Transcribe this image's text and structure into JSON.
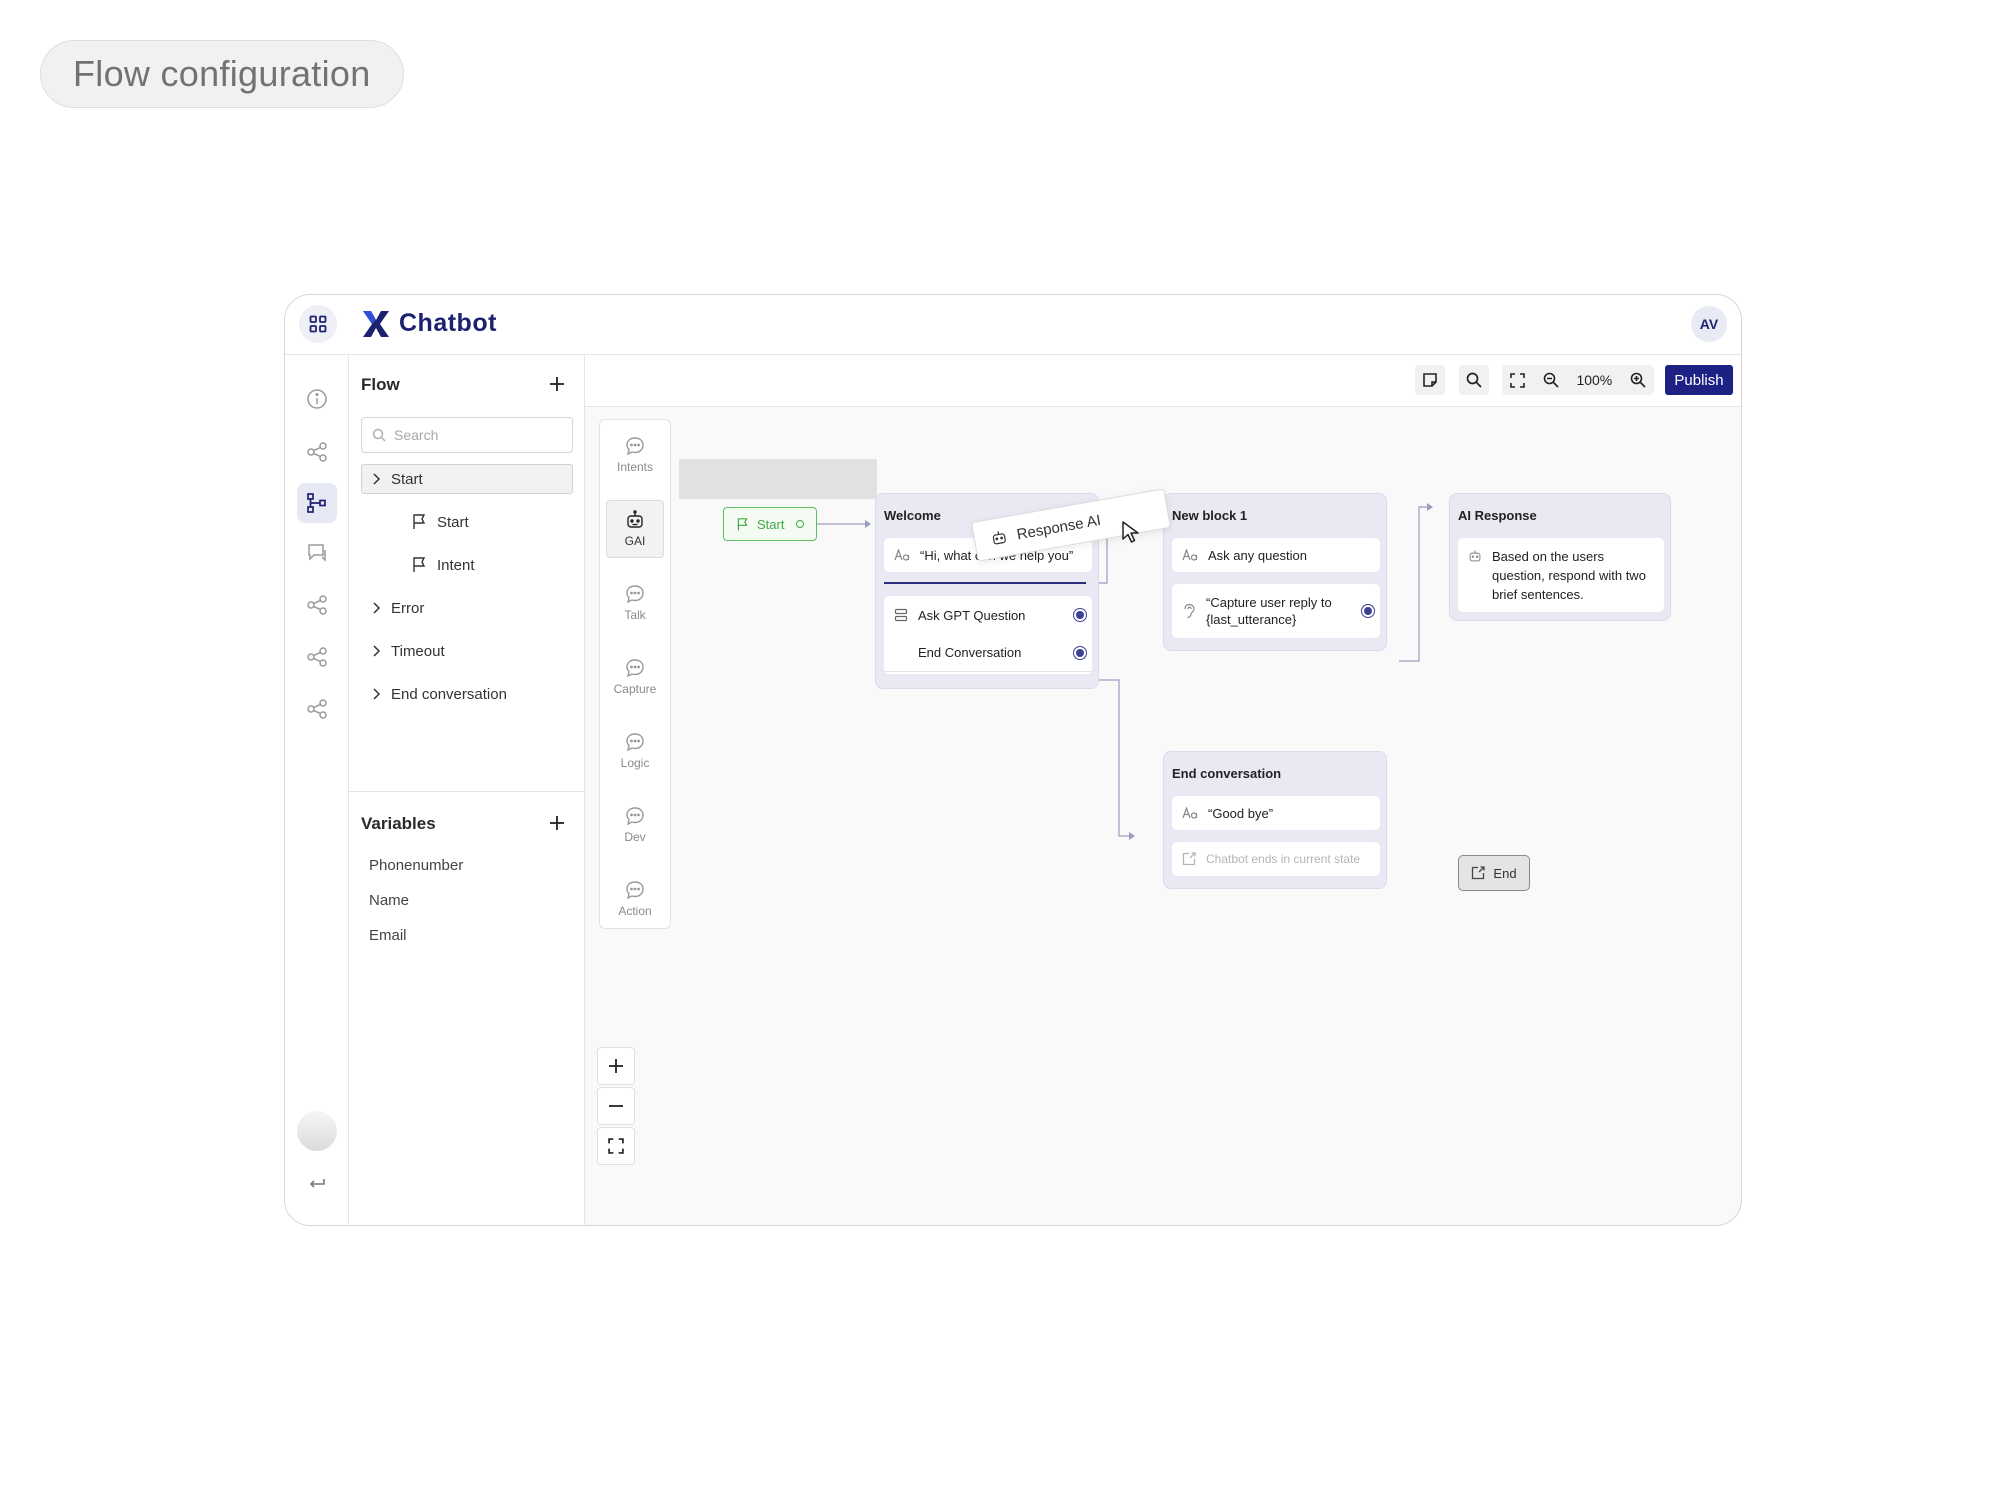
{
  "page_label": "Flow configuration",
  "app": {
    "name": "Chatbot",
    "user_initials": "AV"
  },
  "sidebar": {
    "flow_title": "Flow",
    "search_placeholder": "Search",
    "tree": {
      "start": "Start",
      "start_child_start": "Start",
      "start_child_intent": "Intent",
      "error": "Error",
      "timeout": "Timeout",
      "end_conversation": "End conversation"
    },
    "variables_title": "Variables",
    "variables": [
      "Phonenumber",
      "Name",
      "Email"
    ]
  },
  "toolbar": {
    "zoom": "100%",
    "publish_label": "Publish"
  },
  "palette": [
    "Intents",
    "GAI",
    "Talk",
    "Capture",
    "Logic",
    "Dev",
    "Action"
  ],
  "canvas": {
    "start_node": "Start",
    "drag_preview": "Response AI",
    "welcome": {
      "title": "Welcome",
      "message": "“Hi, what can we help you”",
      "choices": [
        "Ask GPT Question",
        "End Conversation"
      ]
    },
    "new_block": {
      "title": "New block 1",
      "message": "Ask any question",
      "capture": "“Capture user reply to {last_utterance}"
    },
    "ai_response": {
      "title": "AI Response",
      "prompt": "Based on the users question, respond with two brief sentences."
    },
    "end_block": {
      "title": "End conversation",
      "message": "“Good bye”",
      "hint": "Chatbot ends in current state"
    },
    "end_node": "End"
  },
  "colors": {
    "brand": "#1d2183",
    "start_green": "#5cc15b",
    "block_bg": "#e9e9f4"
  }
}
